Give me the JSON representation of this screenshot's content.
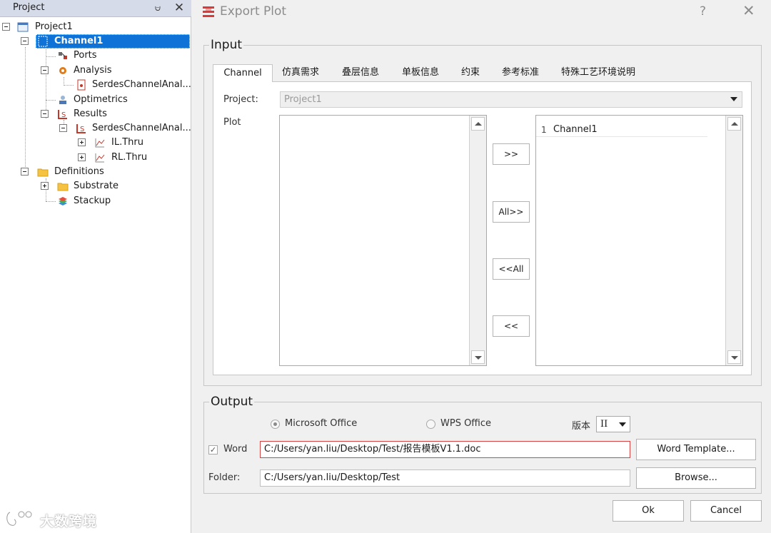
{
  "project_panel": {
    "title": "Project",
    "tree": {
      "project": "Project1",
      "channel": "Channel1",
      "ports": "Ports",
      "analysis": "Analysis",
      "analysis_child": "SerdesChannelAnal...",
      "optimetrics": "Optimetrics",
      "results": "Results",
      "results_child": "SerdesChannelAnal...",
      "il_thru": "IL.Thru",
      "rl_thru": "RL.Thru",
      "definitions": "Definitions",
      "substrate": "Substrate",
      "stackup": "Stackup"
    }
  },
  "dialog": {
    "title": "Export Plot",
    "help": "?",
    "input": {
      "title": "Input",
      "tabs": [
        "Channel",
        "仿真需求",
        "叠层信息",
        "单板信息",
        "约束",
        "参考标准",
        "特殊工艺环境说明"
      ],
      "project_label": "Project:",
      "project_value": "Project1",
      "plot_label": "Plot",
      "buttons": {
        "add": ">>",
        "add_all": "All>>",
        "remove_all": "<<All",
        "remove": "<<"
      },
      "selected_list": [
        {
          "index": "1",
          "value": "Channel1"
        }
      ]
    },
    "output": {
      "title": "Output",
      "options": {
        "microsoft_office": "Microsoft Office",
        "wps_office": "WPS Office",
        "selected": "Microsoft Office"
      },
      "version_label": "版本",
      "version_value": "II",
      "word_label": "Word",
      "word_checked": true,
      "word_path": "C:/Users/yan.liu/Desktop/Test/报告模板V1.1.doc",
      "word_template_button": "Word Template...",
      "folder_label": "Folder:",
      "folder_path": "C:/Users/yan.liu/Desktop/Test",
      "browse_button": "Browse..."
    },
    "ok_button": "Ok",
    "cancel_button": "Cancel"
  },
  "watermark": "大数跨境",
  "colors": {
    "selection": "#0e72d6",
    "error_border": "#d64545"
  }
}
